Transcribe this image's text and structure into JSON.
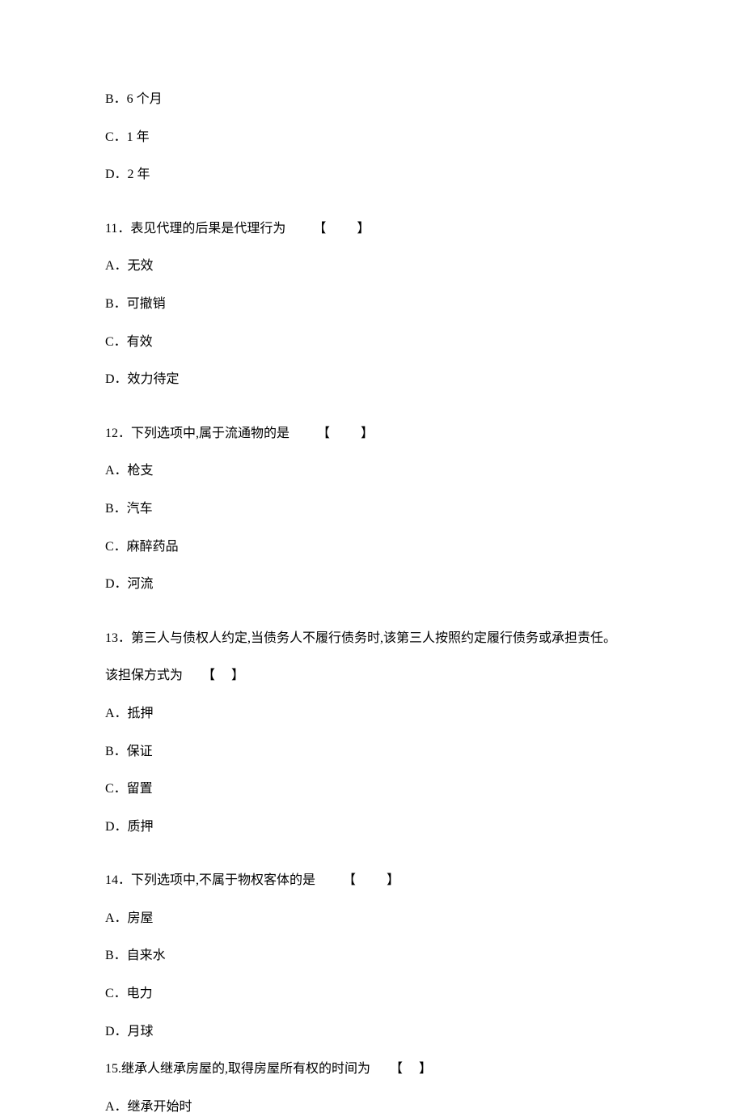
{
  "q10_options": {
    "b": "B．6 个月",
    "c": "C．1 年",
    "d": "D．2 年"
  },
  "q11": {
    "stem": "11．表见代理的后果是代理行为",
    "bracket": "【　　】",
    "a": "A．无效",
    "b": "B．可撤销",
    "c": "C．有效",
    "d": "D．效力待定"
  },
  "q12": {
    "stem": "12．下列选项中,属于流通物的是",
    "bracket": "【　　】",
    "a": "A．枪支",
    "b": "B．汽车",
    "c": "C．麻醉药品",
    "d": "D．河流"
  },
  "q13": {
    "stem_line1": "13．第三人与债权人约定,当债务人不履行债务时,该第三人按照约定履行债务或承担责任。",
    "stem_line2": "该担保方式为",
    "bracket": "【　】",
    "a": "A．抵押",
    "b": "B．保证",
    "c": "C．留置",
    "d": "D．质押"
  },
  "q14": {
    "stem": "14．下列选项中,不属于物权客体的是",
    "bracket": "【　　】",
    "a": "A．房屋",
    "b": "B．自来水",
    "c": "C．电力",
    "d": "D．月球"
  },
  "q15": {
    "stem": "15.继承人继承房屋的,取得房屋所有权的时间为",
    "bracket": "【　】",
    "a": "A．继承开始时"
  }
}
